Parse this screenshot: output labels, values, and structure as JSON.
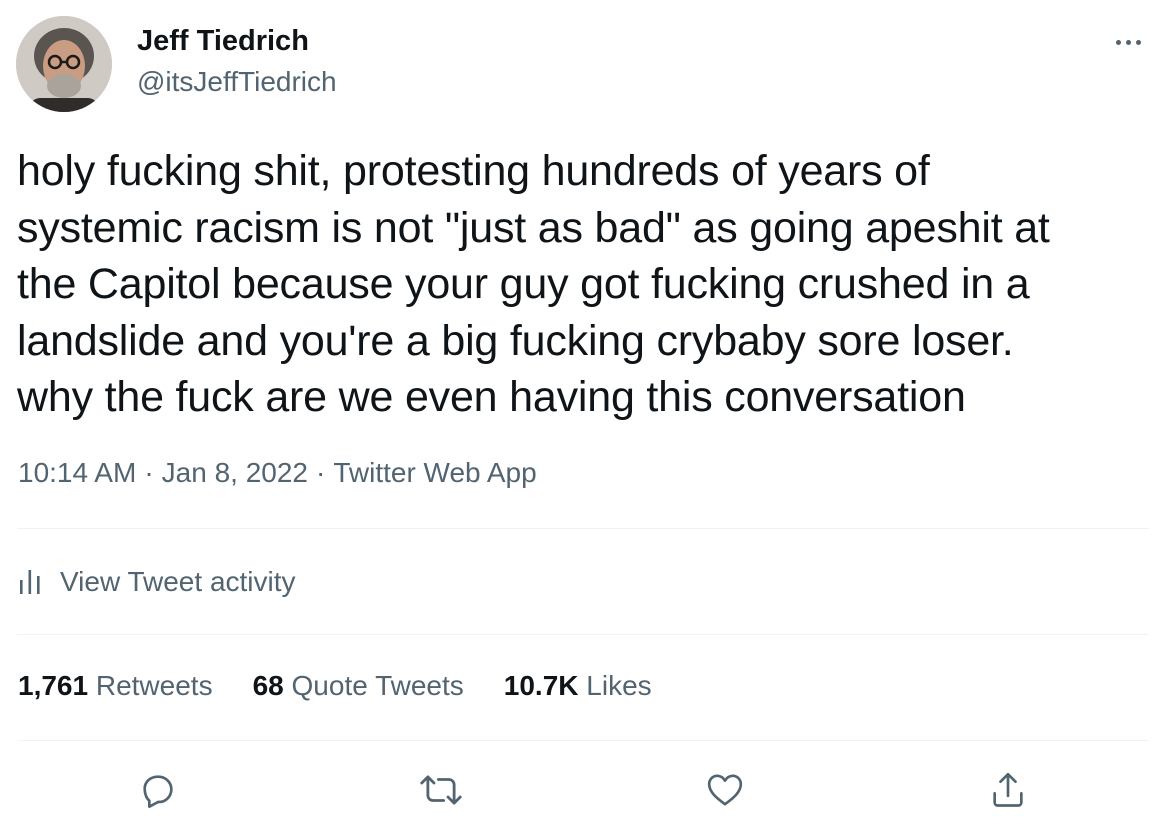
{
  "author": {
    "display_name": "Jeff Tiedrich",
    "handle": "@itsJeffTiedrich"
  },
  "tweet": {
    "text_lines": [
      "holy fucking shit, protesting hundreds of years of",
      "systemic racism is not \"just as bad\" as going apeshit at",
      "the Capitol because your guy got fucking crushed in a",
      "landslide and you're a big fucking crybaby sore loser.",
      "why the fuck are we even having this conversation"
    ],
    "time": "10:14 AM",
    "date": "Jan 8, 2022",
    "source": "Twitter Web App",
    "separator": "·"
  },
  "activity": {
    "label": "View Tweet activity",
    "icon": "bar-chart-icon"
  },
  "stats": {
    "retweets_count": "1,761",
    "retweets_label": "Retweets",
    "quotes_count": "68",
    "quotes_label": "Quote Tweets",
    "likes_count": "10.7K",
    "likes_label": "Likes"
  },
  "actions": {
    "reply_icon": "reply-icon",
    "retweet_icon": "retweet-icon",
    "like_icon": "heart-icon",
    "share_icon": "share-icon"
  },
  "colors": {
    "text_primary": "#0f1419",
    "text_secondary": "#536471",
    "divider": "#eff3f4"
  }
}
